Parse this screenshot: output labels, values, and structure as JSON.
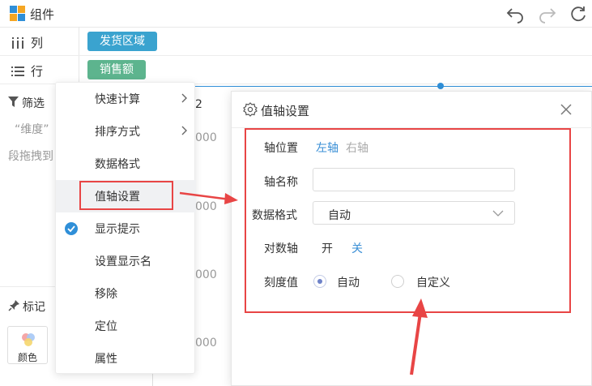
{
  "app": {
    "title": "组件"
  },
  "shelves": {
    "columns": {
      "label": "列",
      "field": "发货区域",
      "color": "#3aa3cf"
    },
    "rows": {
      "label": "行",
      "field": "销售额",
      "color": "#5db48e"
    }
  },
  "sidebar": {
    "filter_label": "筛选",
    "dimension_hint": "“维度”",
    "drag_hint": "段拖拽到",
    "marks_label": "标记",
    "color_button": "颜色"
  },
  "chart": {
    "partial_label": "2",
    "tick_labels": [
      "000",
      "000",
      "000",
      "000"
    ]
  },
  "context_menu": {
    "items": [
      {
        "label": "快速计算",
        "submenu": true
      },
      {
        "label": "排序方式",
        "submenu": true
      },
      {
        "label": "数据格式"
      },
      {
        "label": "值轴设置",
        "highlighted": true
      },
      {
        "label": "显示提示",
        "checked": true
      },
      {
        "label": "设置显示名"
      },
      {
        "label": "移除"
      },
      {
        "label": "定位"
      },
      {
        "label": "属性"
      }
    ]
  },
  "dialog": {
    "title": "值轴设置",
    "axis_position": {
      "label": "轴位置",
      "options": [
        "左轴",
        "右轴"
      ],
      "selected": "左轴"
    },
    "axis_name": {
      "label": "轴名称",
      "value": "",
      "placeholder": ""
    },
    "data_format": {
      "label": "数据格式",
      "value": "自动"
    },
    "log_axis": {
      "label": "对数轴",
      "options": [
        "开",
        "关"
      ],
      "selected": "关"
    },
    "tick_value": {
      "label": "刻度值",
      "options": [
        "自动",
        "自定义"
      ],
      "selected": "自动"
    }
  },
  "colors": {
    "accent": "#3a8fd6",
    "highlight": "#e84545",
    "muted": "#aaaaaa"
  }
}
